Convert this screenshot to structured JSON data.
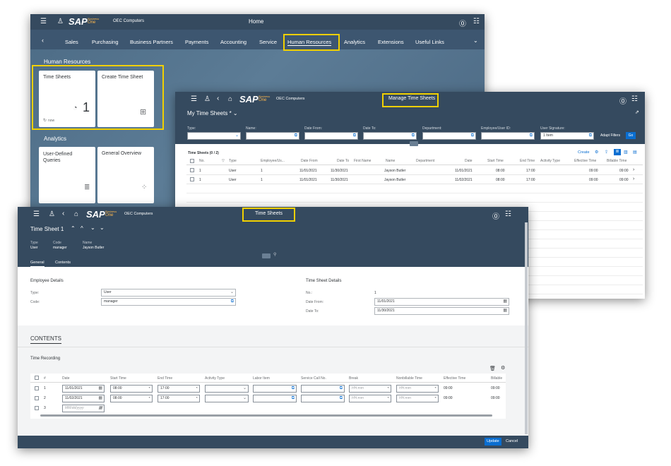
{
  "brand": {
    "logo": "SAP",
    "line1": "Business",
    "line2": "One"
  },
  "home": {
    "company": "OEC Computers",
    "title": "Home",
    "nav": [
      "Sales",
      "Purchasing",
      "Business Partners",
      "Payments",
      "Accounting",
      "Service",
      "Human Resources",
      "Analytics",
      "Extensions",
      "Useful Links"
    ],
    "section_hr": "Human Resources",
    "section_analytics": "Analytics",
    "tiles": {
      "time_sheets": "Time Sheets",
      "time_sheets_value": "1",
      "time_sheets_footer": "now",
      "create": "Create Time Sheet",
      "udq": "User-Defined Queries",
      "overview": "General Overview"
    }
  },
  "manage": {
    "company": "OEC Computers",
    "title": "Manage Time Sheets",
    "variant": "My Time Sheets *",
    "filters": [
      "Type:",
      "Name:",
      "Date From:",
      "Date To:",
      "Department:",
      "Employee/User ID:",
      "User Signature:"
    ],
    "signature_value": "1 Item",
    "adapt": "Adapt Filters",
    "go": "Go",
    "table_title": "Time Sheets (0 / 2)",
    "create": "Create",
    "columns": [
      "No.",
      "Type",
      "Employee/Us...",
      "Date From",
      "Date To",
      "First Name",
      "Name",
      "Department",
      "Date",
      "Start Time",
      "End Time",
      "Activity Type",
      "Effective Time",
      "Billable Time"
    ],
    "rows": [
      {
        "no": "1",
        "type": "User",
        "emp": "1",
        "from": "11/01/2021",
        "to": "11/30/2021",
        "first": "",
        "name": "Jayson Butler",
        "dept": "",
        "date": "11/01/2021",
        "start": "08:00",
        "end": "17:00",
        "act": "",
        "eff": "09:00",
        "bill": "09:00"
      },
      {
        "no": "1",
        "type": "User",
        "emp": "1",
        "from": "11/01/2021",
        "to": "11/30/2021",
        "first": "",
        "name": "Jayson Butler",
        "dept": "",
        "date": "11/02/2021",
        "start": "08:00",
        "end": "17:00",
        "act": "",
        "eff": "09:00",
        "bill": "09:00"
      }
    ]
  },
  "ts": {
    "company": "OEC Computers",
    "title": "Time Sheets",
    "doc_title": "Time Sheet 1",
    "hdr_type_l": "Type",
    "hdr_type_v": "User",
    "hdr_code_l": "Code",
    "hdr_code_v": "manager",
    "hdr_name_l": "Name",
    "hdr_name_v": "Jayson Butler",
    "tab_general": "General",
    "tab_contents": "Contents",
    "emp_section": "Employee Details",
    "type_l": "Type:",
    "type_v": "User",
    "code_l": "Code:",
    "code_v": "manager",
    "ts_section": "Time Sheet Details",
    "no_l": "No.:",
    "no_v": "1",
    "df_l": "Date From:",
    "df_v": "11/01/2021",
    "dt_l": "Date To:",
    "dt_v": "11/30/2021",
    "contents_heading": "CONTENTS",
    "time_recording": "Time Recording",
    "columns": [
      "#",
      "Date",
      "Start Time",
      "End Time",
      "Activity Type",
      "Labor Item",
      "Service Call No.",
      "Break",
      "Nonbillable Time",
      "Effective Time",
      "Billable"
    ],
    "rows": [
      {
        "n": "1",
        "date": "11/01/2021",
        "start": "08:00",
        "end": "17:00",
        "brk": "HH:mm",
        "nb": "HH:mm",
        "eff": "09:00",
        "bill": "09:00"
      },
      {
        "n": "2",
        "date": "11/02/2021",
        "start": "08:00",
        "end": "17:00",
        "brk": "HH:mm",
        "nb": "HH:mm",
        "eff": "09:00",
        "bill": "09:00"
      }
    ],
    "row3_n": "3",
    "row3_date": "MM/dd/yyyy",
    "update": "Update",
    "cancel": "Cancel"
  },
  "colors": {
    "shell": "#354a5f",
    "highlight": "#f1d000",
    "accent": "#0a6ed1"
  }
}
